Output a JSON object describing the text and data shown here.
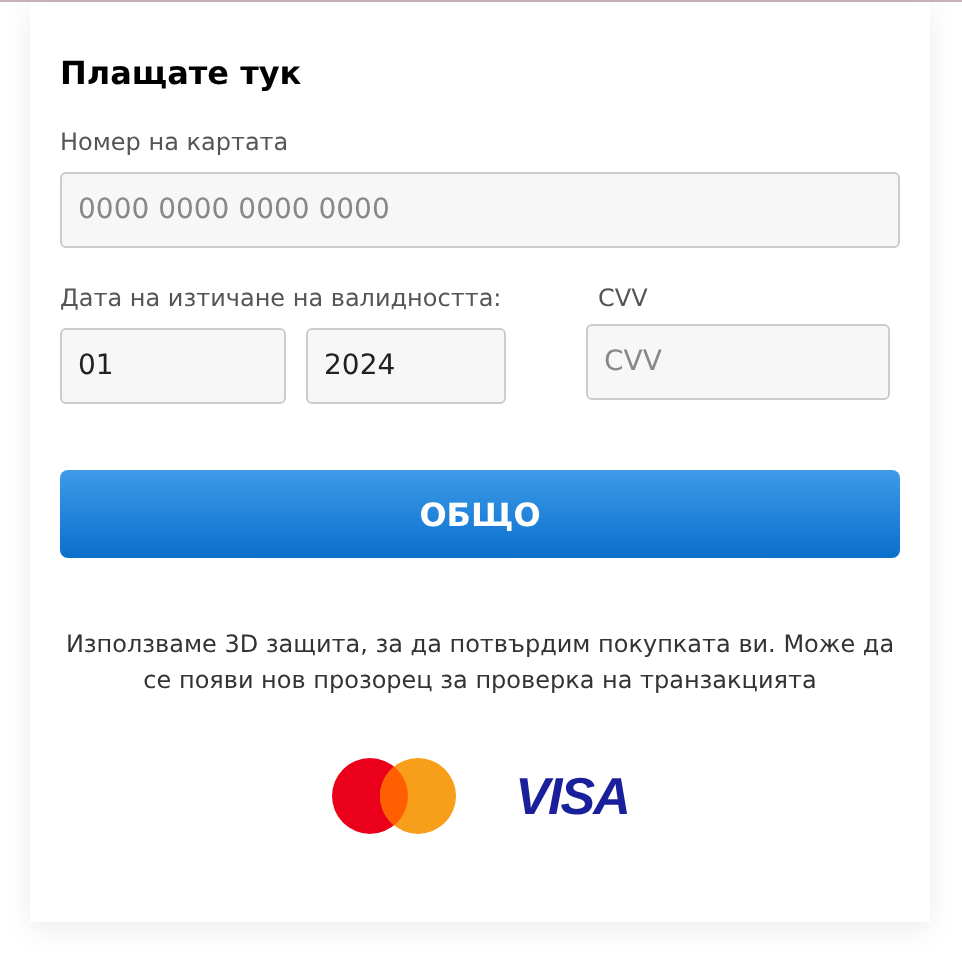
{
  "title": "Плащате тук",
  "card_number": {
    "label": "Номер на картата",
    "placeholder": "0000 0000 0000 0000"
  },
  "expiry": {
    "label": "Дата на изтичане на валидността:",
    "month": "01",
    "year": "2024"
  },
  "cvv": {
    "label": "CVV",
    "placeholder": "CVV"
  },
  "submit_button": "ОБЩО",
  "notice": "Използваме 3D защита, за да потвърдим покупката ви. Може да се появи нов прозорец за проверка на транзакцията",
  "brands": [
    {
      "kind": "mastercard"
    },
    {
      "kind": "visa",
      "text": "VISA"
    }
  ]
}
